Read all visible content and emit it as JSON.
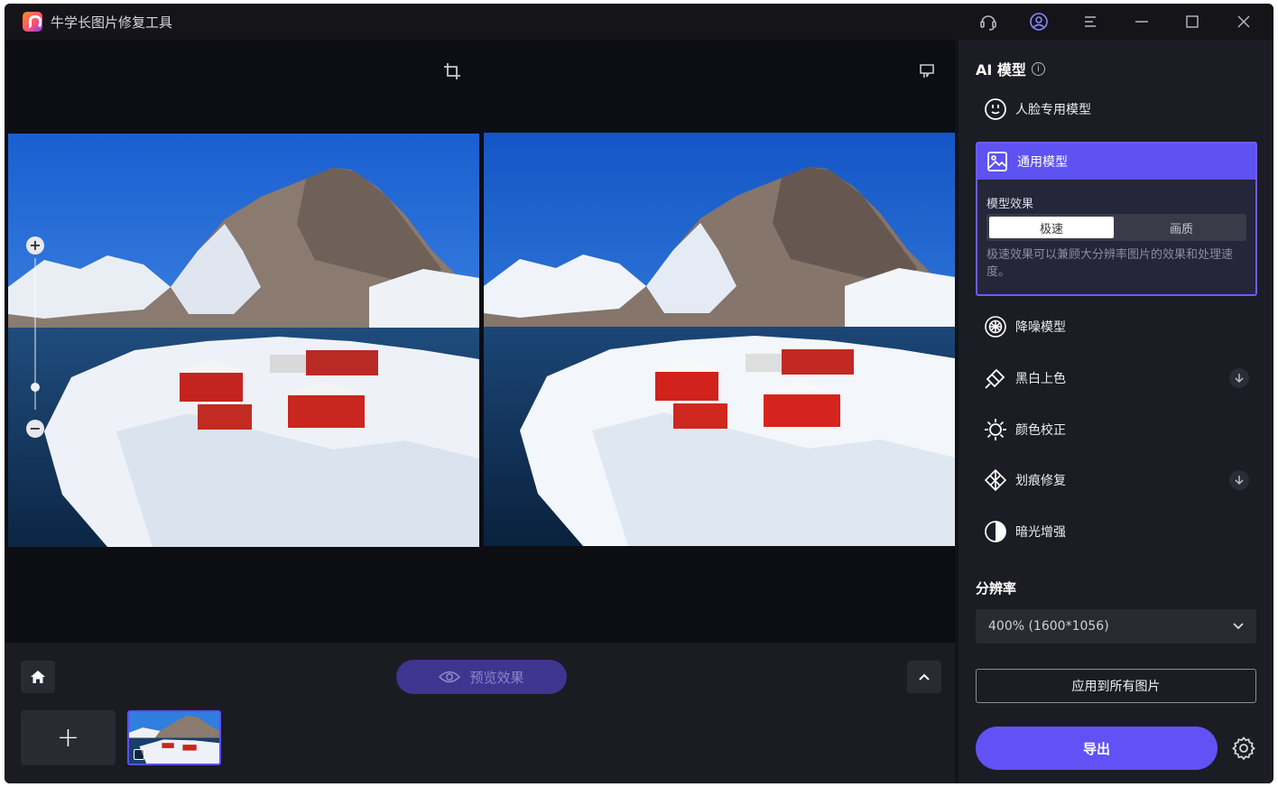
{
  "app": {
    "title": "牛学长图片修复工具"
  },
  "titlebar": {
    "icons": [
      "support-icon",
      "user-account-icon",
      "menu-icon",
      "minimize-icon",
      "maximize-icon",
      "close-icon"
    ]
  },
  "canvas": {
    "tools": [
      "crop-icon",
      "feedback-icon"
    ],
    "zoom": {
      "in_label": "+",
      "out_label": "−",
      "level": 0.15
    }
  },
  "bottombar": {
    "preview_label": "预览效果",
    "add_label": "+"
  },
  "panel": {
    "title": "AI 模型",
    "models": [
      {
        "label": "人脸专用模型",
        "icon": "face-icon"
      },
      {
        "label": "通用模型",
        "icon": "image-icon",
        "active": true
      },
      {
        "label": "降噪模型",
        "icon": "denoise-icon"
      },
      {
        "label": "黑白上色",
        "icon": "colorize-icon",
        "download": true
      },
      {
        "label": "颜色校正",
        "icon": "sun-icon"
      },
      {
        "label": "划痕修复",
        "icon": "scratch-icon",
        "download": true
      },
      {
        "label": "暗光增强",
        "icon": "contrast-icon"
      }
    ],
    "effect": {
      "label": "模型效果",
      "options": [
        "极速",
        "画质"
      ],
      "selected": "极速",
      "description": "极速效果可以兼顾大分辨率图片的效果和处理速度。"
    },
    "resolution": {
      "label": "分辨率",
      "value": "400% (1600*1056)"
    },
    "apply_all_label": "应用到所有图片",
    "export_label": "导出"
  },
  "colors": {
    "accent": "#6252f5",
    "background": "#121218",
    "panel": "#1c1c24"
  }
}
